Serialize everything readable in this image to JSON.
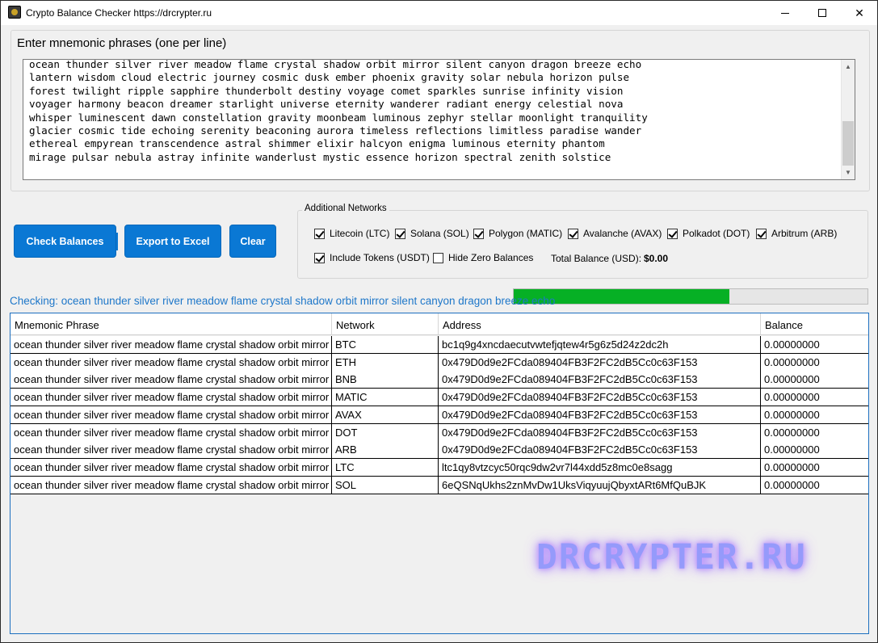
{
  "window": {
    "title": "Crypto Balance Checker https://drcrypter.ru",
    "minimize_glyph": "—",
    "close_glyph": "✕"
  },
  "mnemonic": {
    "group_title": "Enter mnemonic phrases (one per line)",
    "lines": [
      "ocean thunder silver river meadow flame crystal shadow orbit mirror silent canyon dragon breeze echo",
      "lantern wisdom cloud electric journey cosmic dusk ember phoenix gravity solar nebula horizon pulse",
      "forest twilight ripple sapphire thunderbolt destiny voyage comet sparkles sunrise infinity vision",
      "voyager harmony beacon dreamer starlight universe eternity wanderer radiant energy celestial nova",
      "whisper luminescent dawn constellation gravity moonbeam luminous zephyr stellar moonlight tranquility",
      "glacier cosmic tide echoing serenity beaconing aurora timeless reflections limitless paradise wander",
      "ethereal empyrean transcendence astral shimmer elixir halcyon enigma luminous eternity phantom",
      "mirage pulsar nebula astray infinite wanderlust mystic essence horizon spectral zenith solstice"
    ]
  },
  "buttons": {
    "check": "Check Balances",
    "export": "Export to Excel",
    "clear": "Clear"
  },
  "networks": {
    "group_title": "Additional Networks",
    "options": [
      {
        "label": "Litecoin (LTC)",
        "checked": true
      },
      {
        "label": "Solana (SOL)",
        "checked": true
      },
      {
        "label": "Polygon (MATIC)",
        "checked": true
      },
      {
        "label": "Avalanche (AVAX)",
        "checked": true
      },
      {
        "label": "Polkadot (DOT)",
        "checked": true
      },
      {
        "label": "Arbitrum (ARB)",
        "checked": true
      },
      {
        "label": "Include Tokens (USDT)",
        "checked": true
      },
      {
        "label": "Hide Zero Balances",
        "checked": false
      }
    ],
    "total_label": "Total Balance (USD):",
    "total_value": "$0.00"
  },
  "status": {
    "text": "Checking: ocean thunder silver river meadow flame crystal shadow orbit mirror silent canyon dragon breeze echo",
    "progress": 0.61,
    "progress_color": "#06b025"
  },
  "grid": {
    "headers": [
      "Mnemonic Phrase",
      "Network",
      "Address",
      "Balance"
    ],
    "rows": [
      [
        "ocean thunder silver river meadow flame crystal shadow orbit mirror silent canyon dragon breeze echo",
        "BTC",
        "bc1q9g4xncdaecutvwtefjqtew4r5g6z5d24z2dc2h",
        "0.00000000"
      ],
      [
        "ocean thunder silver river meadow flame crystal shadow orbit mirror silent canyon dragon breeze echo",
        "ETH",
        "0x479D0d9e2FCda089404FB3F2FC2dB5Cc0c63F153",
        "0.00000000"
      ],
      [
        "ocean thunder silver river meadow flame crystal shadow orbit mirror silent canyon dragon breeze echo",
        "BNB",
        "0x479D0d9e2FCda089404FB3F2FC2dB5Cc0c63F153",
        "0.00000000"
      ],
      [
        "ocean thunder silver river meadow flame crystal shadow orbit mirror silent canyon dragon breeze echo",
        "MATIC",
        "0x479D0d9e2FCda089404FB3F2FC2dB5Cc0c63F153",
        "0.00000000"
      ],
      [
        "ocean thunder silver river meadow flame crystal shadow orbit mirror silent canyon dragon breeze echo",
        "AVAX",
        "0x479D0d9e2FCda089404FB3F2FC2dB5Cc0c63F153",
        "0.00000000"
      ],
      [
        "ocean thunder silver river meadow flame crystal shadow orbit mirror silent canyon dragon breeze echo",
        "DOT",
        "0x479D0d9e2FCda089404FB3F2FC2dB5Cc0c63F153",
        "0.00000000"
      ],
      [
        "ocean thunder silver river meadow flame crystal shadow orbit mirror silent canyon dragon breeze echo",
        "ARB",
        "0x479D0d9e2FCda089404FB3F2FC2dB5Cc0c63F153",
        "0.00000000"
      ],
      [
        "ocean thunder silver river meadow flame crystal shadow orbit mirror silent canyon dragon breeze echo",
        "LTC",
        "ltc1qy8vtzcyc50rqc9dw2vr7l44xdd5z8mc0e8sagg",
        "0.00000000"
      ],
      [
        "ocean thunder silver river meadow flame crystal shadow orbit mirror silent canyon dragon breeze echo",
        "SOL",
        "6eQSNqUkhs2znMvDw1UksViqyuujQbyxtARt6MfQuBJK",
        "0.00000000"
      ]
    ]
  },
  "watermark": "DRCRYPTER.RU"
}
